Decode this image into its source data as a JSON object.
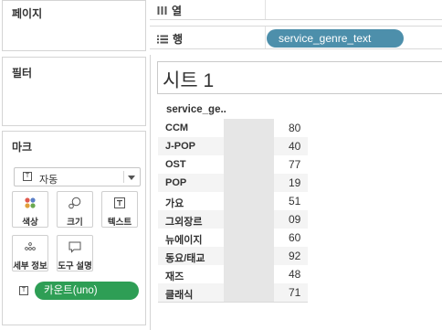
{
  "panes": {
    "pages_title": "페이지",
    "filters_title": "필터",
    "marks_title": "마크"
  },
  "marks": {
    "type_value": "자동",
    "type_icon_text": "T",
    "buttons": {
      "color": "색상",
      "size": "크기",
      "text": "텍스트",
      "detail": "세부 정보",
      "tooltip": "도구 설명"
    },
    "measure_pill": "카운트(uno)",
    "accent_colors": {
      "measure": "#2e9e55",
      "dimension": "#4d8fab"
    }
  },
  "shelves": {
    "columns_label": "열",
    "rows_label": "행",
    "rows_pill": "service_genre_text"
  },
  "sheet": {
    "title": "시트 1",
    "column_header": "service_ge..",
    "rows": [
      {
        "category": "CCM",
        "value": "80"
      },
      {
        "category": "J-POP",
        "value": "40"
      },
      {
        "category": "OST",
        "value": "77"
      },
      {
        "category": "POP",
        "value": "19"
      },
      {
        "category": "가요",
        "value": "51"
      },
      {
        "category": "그외장르",
        "value": "09"
      },
      {
        "category": "뉴에이지",
        "value": "60"
      },
      {
        "category": "동요/태교",
        "value": "92"
      },
      {
        "category": "재즈",
        "value": "48"
      },
      {
        "category": "클래식",
        "value": "71"
      }
    ]
  }
}
